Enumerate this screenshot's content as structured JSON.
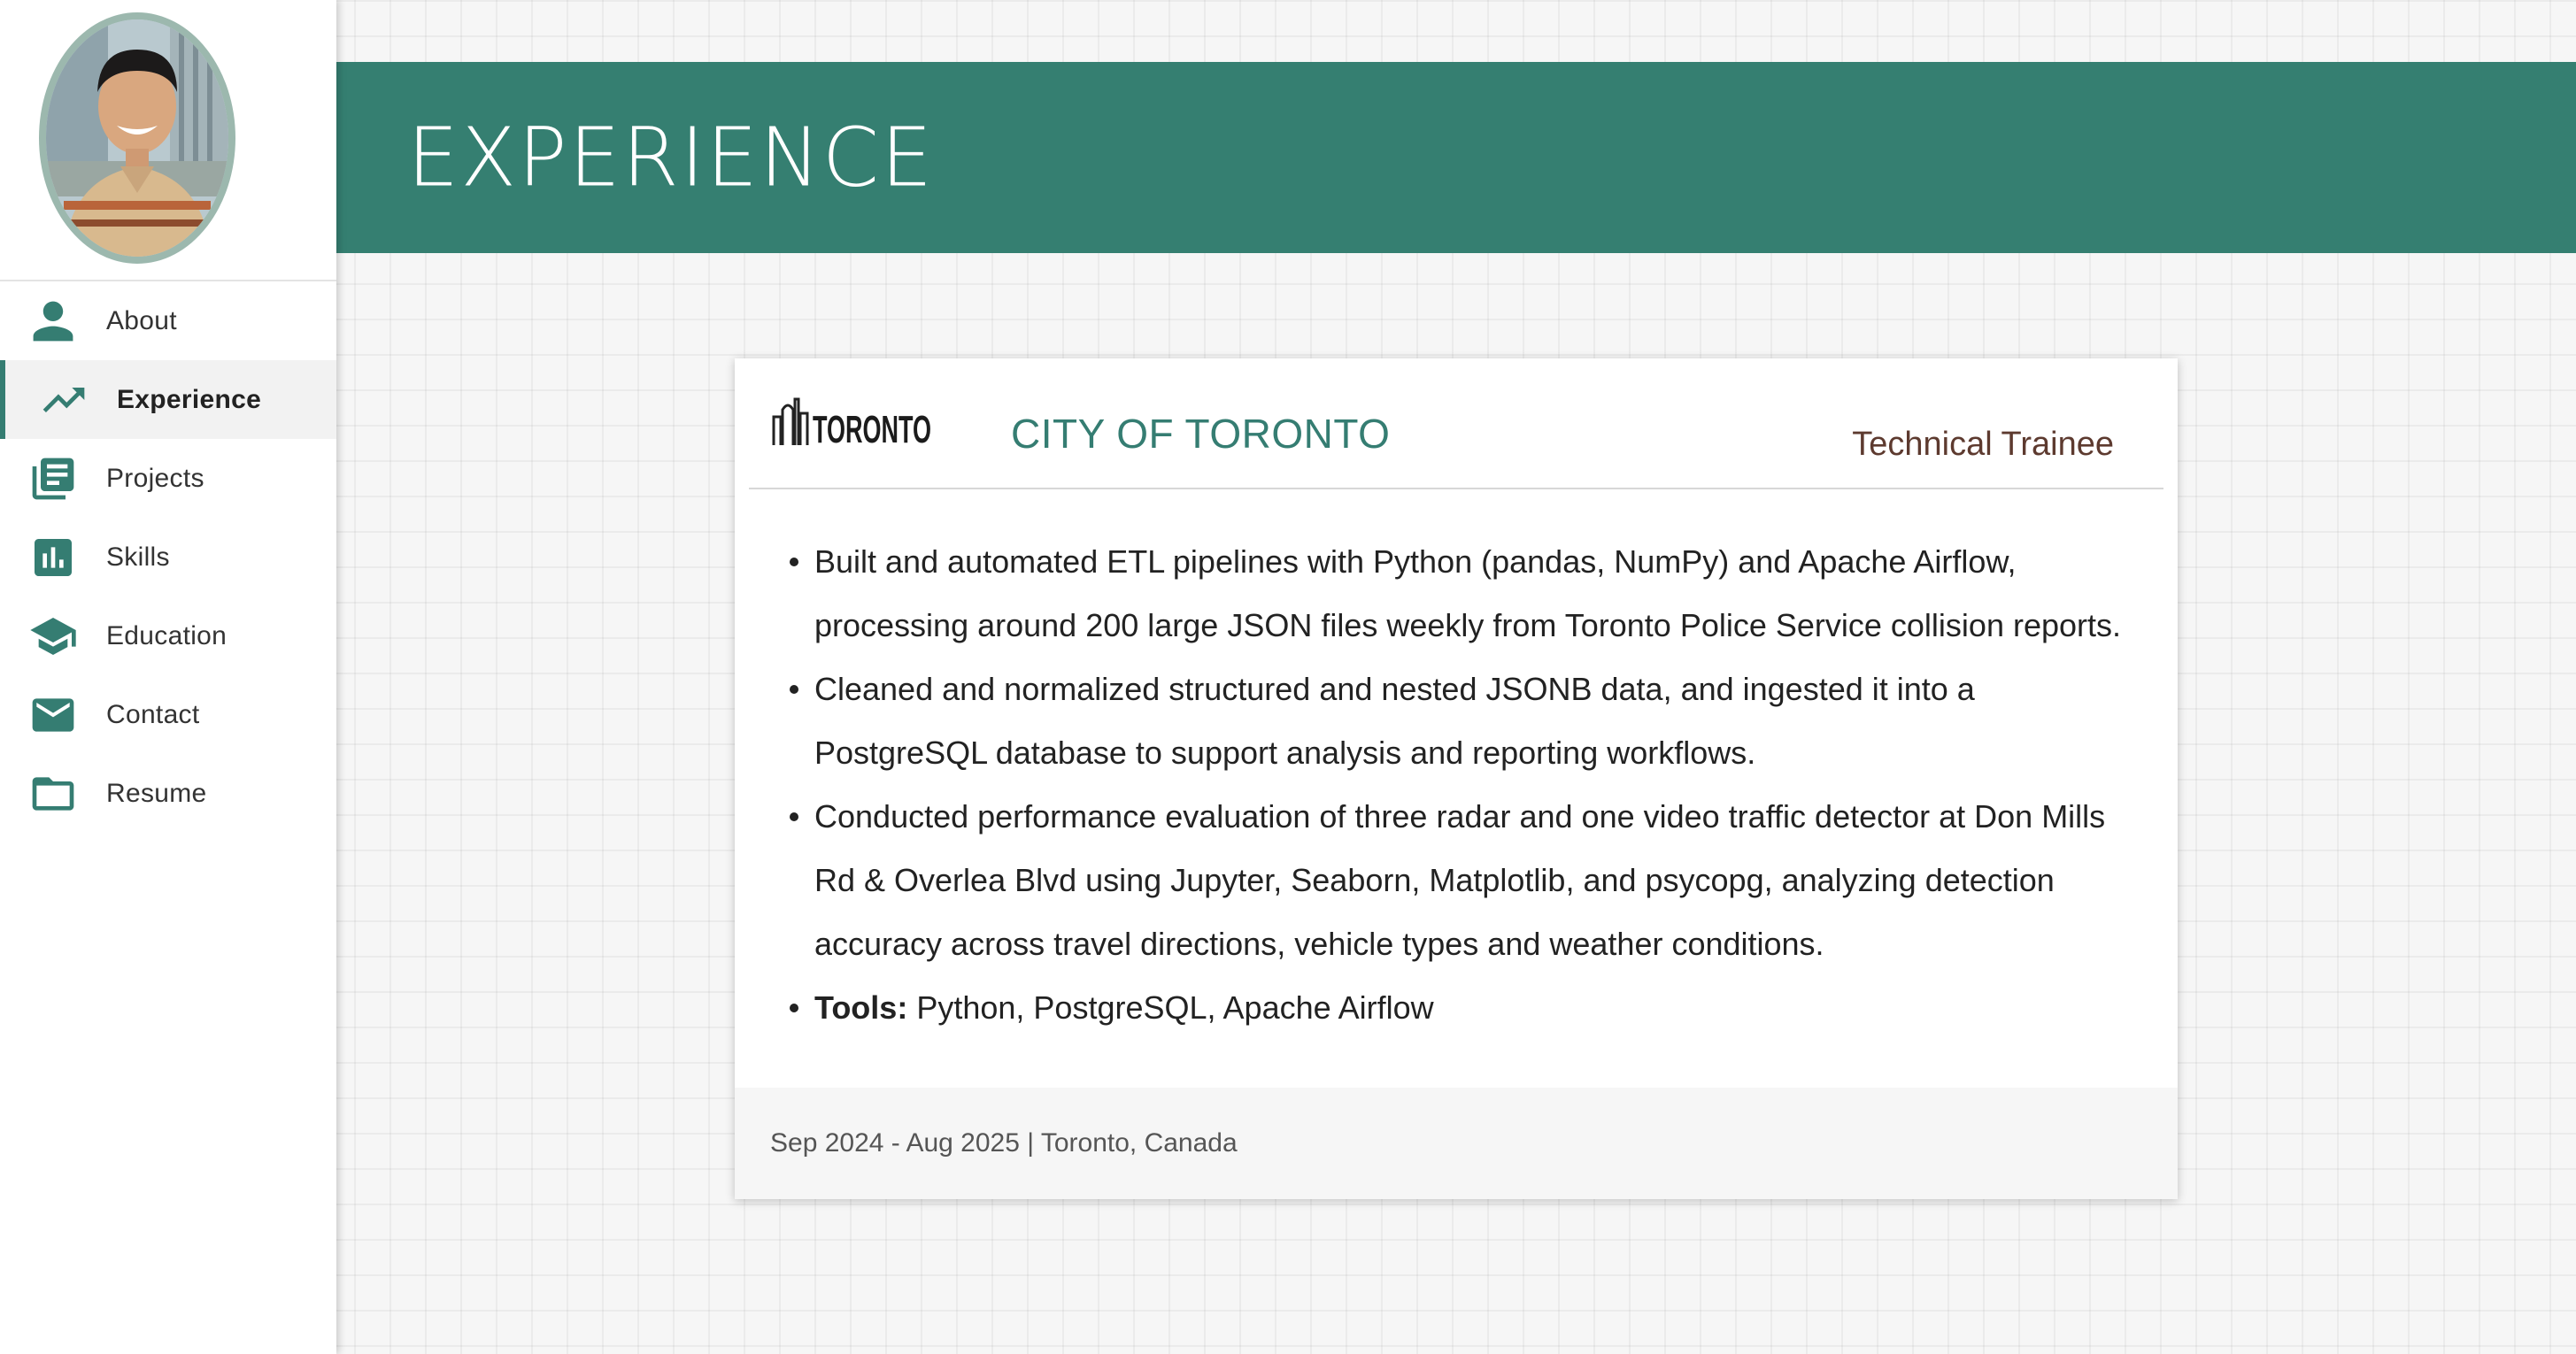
{
  "sidebar": {
    "items": [
      {
        "label": "About",
        "icon": "person-icon"
      },
      {
        "label": "Experience",
        "icon": "trending-up-icon",
        "active": true
      },
      {
        "label": "Projects",
        "icon": "library-books-icon"
      },
      {
        "label": "Skills",
        "icon": "bar-chart-icon"
      },
      {
        "label": "Education",
        "icon": "graduation-cap-icon"
      },
      {
        "label": "Contact",
        "icon": "mail-icon"
      },
      {
        "label": "Resume",
        "icon": "folder-icon"
      }
    ]
  },
  "header": {
    "title": "EXPERIENCE"
  },
  "experience": {
    "logo_text": "TORONTO",
    "organization": "CITY OF TORONTO",
    "role": "Technical Trainee",
    "bullets": [
      "Built and automated ETL pipelines with Python (pandas, NumPy) and Apache Airflow, processing around 200 large JSON files weekly from Toronto Police Service collision reports.",
      "Cleaned and normalized structured and nested JSONB data, and ingested it into a PostgreSQL database to support analysis and reporting workflows.",
      "Conducted performance evaluation of three radar and one video traffic detector at Don Mills Rd & Overlea Blvd using Jupyter, Seaborn, Matplotlib, and psycopg, analyzing detection accuracy across travel directions, vehicle types and weather conditions."
    ],
    "tools_label": "Tools:",
    "tools_value": "Python, PostgreSQL, Apache Airflow",
    "footer": "Sep 2024 - Aug 2025 | Toronto, Canada"
  },
  "colors": {
    "accent": "#357f71",
    "role_text": "#5d3a2f",
    "avatar_border": "#9cb8ae"
  }
}
